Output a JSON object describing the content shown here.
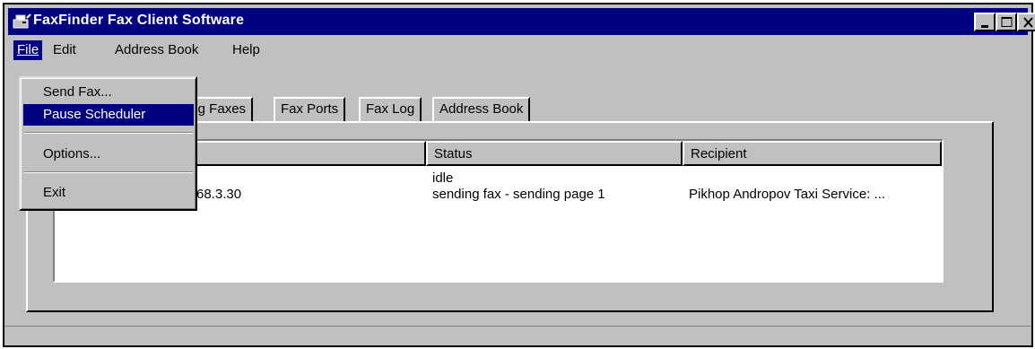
{
  "window": {
    "title": "FaxFinder Fax Client Software"
  },
  "menubar": {
    "file": "File",
    "edit": "Edit",
    "address_book": "Address Book",
    "help": "Help"
  },
  "file_menu": {
    "send_fax": "Send Fax...",
    "pause_scheduler": "Pause Scheduler",
    "options": "Options...",
    "exit": "Exit"
  },
  "tabs": {
    "pending_faxes_partial": "ing Faxes",
    "fax_ports": "Fax Ports",
    "fax_log": "Fax Log",
    "address_book": "Address Book"
  },
  "list": {
    "columns": [
      "Status",
      "Recipient"
    ],
    "rows": [
      {
        "port_partial": "",
        "status": "idle",
        "recipient": ""
      },
      {
        "port_partial": "68.3.30",
        "status": "sending fax - sending page 1",
        "recipient": "Pikhop Andropov Taxi Service: ..."
      }
    ]
  },
  "colors": {
    "titlebar": "#000080",
    "face": "#c0c0c0",
    "highlight": "#000080"
  },
  "icons": {
    "app": "fax-machine-icon",
    "minimize": "minimize-icon",
    "maximize": "maximize-icon",
    "close": "close-icon"
  }
}
